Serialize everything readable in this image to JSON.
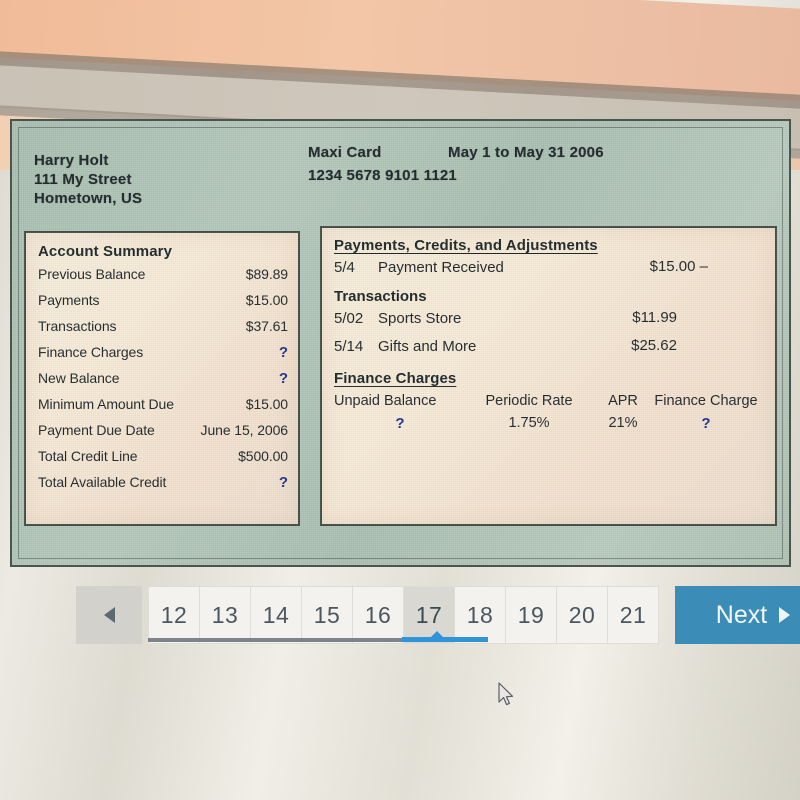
{
  "statement": {
    "customer": {
      "name": "Harry Holt",
      "street": "111 My Street",
      "city_state": "Hometown, US"
    },
    "card": {
      "name": "Maxi Card",
      "number": "1234 5678 9101 1121",
      "period": "May 1 to May 31 2006"
    },
    "account_summary": {
      "title": "Account Summary",
      "rows": [
        {
          "label": "Previous Balance",
          "value": "$89.89"
        },
        {
          "label": "Payments",
          "value": "$15.00"
        },
        {
          "label": "Transactions",
          "value": "$37.61"
        },
        {
          "label": "Finance Charges",
          "value": "?"
        },
        {
          "label": "New Balance",
          "value": "?"
        },
        {
          "label": "Minimum Amount Due",
          "value": "$15.00"
        },
        {
          "label": "Payment Due Date",
          "value": "June 15, 2006"
        },
        {
          "label": "Total Credit Line",
          "value": "$500.00"
        },
        {
          "label": "Total Available Credit",
          "value": "?"
        }
      ]
    },
    "payments_section": {
      "title": "Payments, Credits, and Adjustments",
      "rows": [
        {
          "date": "5/4",
          "description": "Payment Received",
          "amount": "$15.00 –"
        }
      ]
    },
    "transactions_section": {
      "title": "Transactions",
      "rows": [
        {
          "date": "5/02",
          "description": "Sports Store",
          "amount": "$11.99"
        },
        {
          "date": "5/14",
          "description": "Gifts and More",
          "amount": "$25.62"
        }
      ]
    },
    "finance_charges": {
      "title": "Finance Charges",
      "columns": [
        "Unpaid Balance",
        "Periodic Rate",
        "APR",
        "Finance Charge"
      ],
      "values": [
        "?",
        "1.75%",
        "21%",
        "?"
      ]
    }
  },
  "pagination": {
    "prev_icon": "triangle-left-icon",
    "pages": [
      "12",
      "13",
      "14",
      "15",
      "16",
      "17",
      "18",
      "19",
      "20",
      "21"
    ],
    "active_page": "17",
    "next_label": "Next",
    "next_icon": "triangle-right-icon"
  },
  "colors": {
    "accent_blue": "#3c8cb8",
    "active_underline": "#2f94d8",
    "question_blue": "#18308f",
    "statement_background": "#aec3b4",
    "panel_background": "#f4e8d5"
  },
  "cursor": {
    "icon": "mouse-pointer-icon"
  }
}
